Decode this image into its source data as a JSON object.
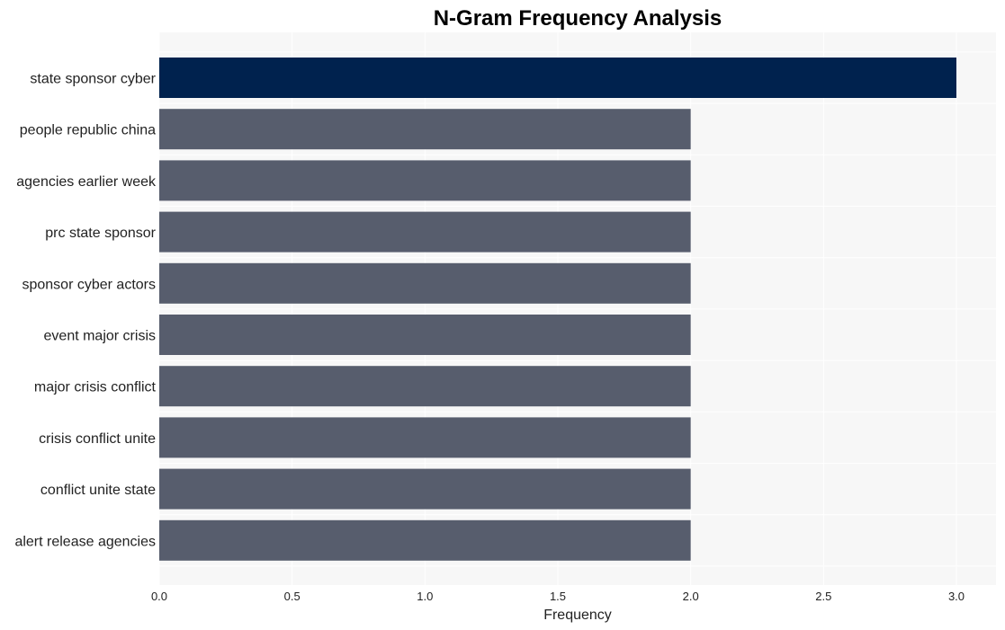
{
  "chart_data": {
    "type": "bar",
    "orientation": "horizontal",
    "title": "N-Gram Frequency Analysis",
    "xlabel": "Frequency",
    "ylabel": "",
    "categories": [
      "state sponsor cyber",
      "people republic china",
      "agencies earlier week",
      "prc state sponsor",
      "sponsor cyber actors",
      "event major crisis",
      "major crisis conflict",
      "crisis conflict unite",
      "conflict unite state",
      "alert release agencies"
    ],
    "values": [
      3,
      2,
      2,
      2,
      2,
      2,
      2,
      2,
      2,
      2
    ],
    "xlim": [
      0,
      3.15
    ],
    "xticks": [
      0.0,
      0.5,
      1.0,
      1.5,
      2.0,
      2.5,
      3.0
    ],
    "xtick_labels": [
      "0.0",
      "0.5",
      "1.0",
      "1.5",
      "2.0",
      "2.5",
      "3.0"
    ],
    "grid": true,
    "legend": "none",
    "colors": {
      "highlight": "#00224e",
      "default": "#575d6d",
      "plot_background": "#f7f7f7",
      "grid": "#ffffff"
    }
  }
}
